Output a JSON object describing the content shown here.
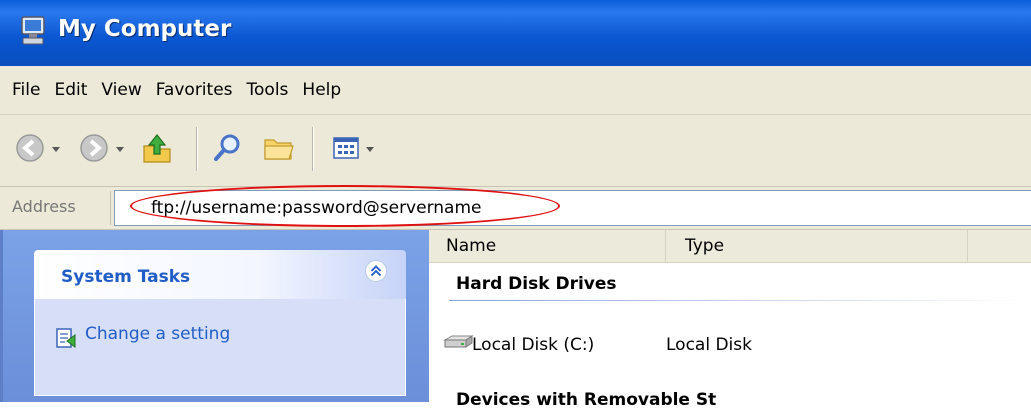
{
  "window": {
    "title": "My Computer",
    "title_icon": "my-computer-icon"
  },
  "menu": {
    "items": [
      "File",
      "Edit",
      "View",
      "Favorites",
      "Tools",
      "Help"
    ]
  },
  "toolbar": {
    "buttons": [
      "back-icon",
      "forward-icon",
      "up-folder-icon",
      "search-icon",
      "folders-icon",
      "views-icon"
    ]
  },
  "address": {
    "label": "Address",
    "value": "ftp://username:password@servername",
    "highlight_color": "#e01010"
  },
  "task_pane": {
    "section_title": "System Tasks",
    "tasks": [
      {
        "label": "Change a setting",
        "icon": "change-setting-icon"
      }
    ]
  },
  "content": {
    "columns": [
      "Name",
      "Type"
    ],
    "groups": [
      {
        "title": "Hard Disk Drives",
        "items": [
          {
            "name": "Local Disk (C:)",
            "type": "Local Disk",
            "icon": "hard-disk-icon"
          }
        ]
      },
      {
        "title": "Devices with Removable St"
      }
    ]
  },
  "colors": {
    "titlebar": "#0b58d2",
    "chrome": "#ece9d8",
    "task_pane": "#6b8fd9",
    "link": "#215dc6"
  }
}
